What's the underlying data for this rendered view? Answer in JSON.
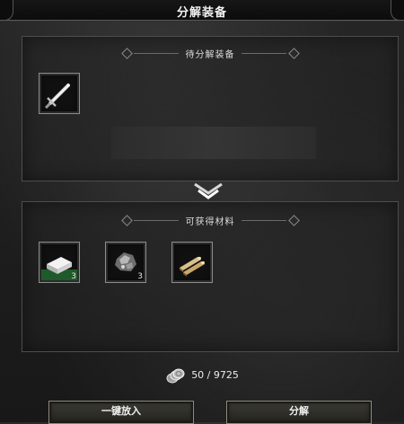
{
  "window": {
    "title": "分解装备"
  },
  "equipment_section": {
    "header": "待分解装备",
    "item": {
      "icon": "dagger-icon"
    },
    "item_name": " "
  },
  "materials_section": {
    "header": "可获得材料",
    "items": [
      {
        "icon": "silver-ingot-icon",
        "count": "3"
      },
      {
        "icon": "ore-chunk-icon",
        "count": "3"
      },
      {
        "icon": "wood-planks-icon",
        "count": ""
      }
    ]
  },
  "currency": {
    "icon": "coin-stack-icon",
    "amount": "50 / 9725"
  },
  "buttons": {
    "put_all_label": "一键放入",
    "decompose_label": "分解"
  },
  "colors": {
    "frame": "#8d8d8d",
    "button_border": "#8f8a74",
    "background": "#1d1d1d"
  }
}
